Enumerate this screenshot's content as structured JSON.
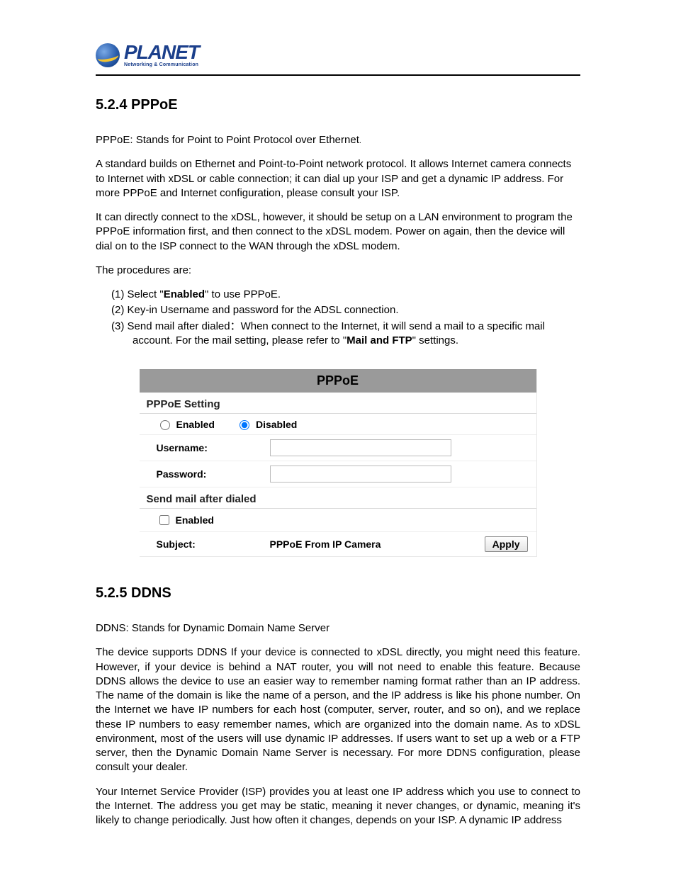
{
  "brand": {
    "name": "PLANET",
    "tagline": "Networking & Communication"
  },
  "section524": {
    "heading": "5.2.4 PPPoE",
    "p1_a": "PPPoE: Stands for Point to Point Protocol over Ethernet",
    "p1_b": ".",
    "p2": "A standard builds on Ethernet and Point-to-Point network protocol. It allows Internet camera connects to Internet with xDSL or cable connection; it can dial up your ISP and get a dynamic IP address. For more PPPoE and Internet configuration, please consult your ISP.",
    "p3": "It can directly connect to the xDSL, however, it should be setup on a LAN environment to program the PPPoE information first, and then connect to the xDSL modem. Power on again, then the device will dial on to the ISP connect to the WAN through the xDSL modem.",
    "p4": "The procedures are:",
    "steps": {
      "s1_a": "(1) Select \"",
      "s1_b": "Enabled",
      "s1_c": "\" to use PPPoE.",
      "s2": "(2) Key-in Username and password for the ADSL connection.",
      "s3_a": "(3) Send mail after dialed：When connect to the Internet, it will send a mail to a specific mail account. For the mail setting, please refer to \"",
      "s3_b": "Mail and FTP",
      "s3_c": "\" settings."
    }
  },
  "panel": {
    "title": "PPPoE",
    "setting_label": "PPPoE Setting",
    "enabled_label": "Enabled",
    "disabled_label": "Disabled",
    "username_label": "Username:",
    "password_label": "Password:",
    "username_value": "",
    "password_value": "",
    "send_mail_label": "Send mail after dialed",
    "send_mail_enabled_label": "Enabled",
    "subject_label": "Subject:",
    "subject_value": "PPPoE From IP Camera",
    "apply_label": "Apply"
  },
  "section525": {
    "heading": "5.2.5 DDNS",
    "p1": "DDNS: Stands for Dynamic Domain Name Server",
    "p2": "The device supports DDNS If your device is connected to xDSL directly, you might need this feature. However, if your device is behind a NAT router, you will not need to enable this feature. Because DDNS allows the device to use an easier way to remember naming format rather than an IP address. The name of the domain is like the name of a person, and the IP address is like his phone number. On the Internet we have IP numbers for each host (computer, server, router, and so on), and we replace these IP numbers to easy remember names, which are organized into the domain name. As to xDSL environment, most of the users will use dynamic IP addresses. If users want to set up a web or a FTP server, then the Dynamic Domain Name Server is necessary. For more DDNS configuration, please consult your dealer.",
    "p3": "Your Internet Service Provider (ISP) provides you at least one IP address which you use to connect to the Internet. The address you get may be static, meaning it never changes, or dynamic, meaning it's likely to change periodically. Just how often it changes, depends on your ISP. A dynamic IP address"
  }
}
